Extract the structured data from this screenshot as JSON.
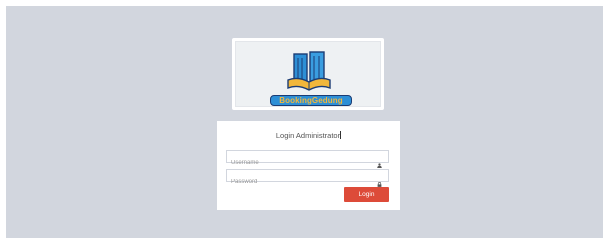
{
  "logo": {
    "icon": "building-book-icon",
    "text": "BookingGedung"
  },
  "login": {
    "title": "Login Administrator",
    "username_placeholder": "Username",
    "password_placeholder": "Password",
    "submit_label": "Login",
    "user_icon": "user-icon",
    "lock_icon": "lock-icon"
  },
  "colors": {
    "page_background": "#d2d6de",
    "button_red": "#dd4b39",
    "logo_blue": "#2d8fd6",
    "logo_orange": "#f1b73b"
  }
}
